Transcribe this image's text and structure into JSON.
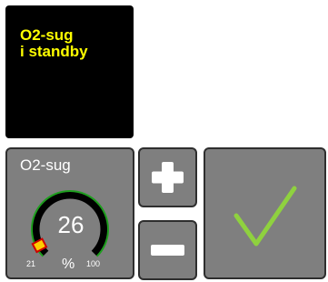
{
  "status": {
    "line1": "O2-sug",
    "line2": "i standby",
    "text_color": "#ffff00",
    "background": "#000000"
  },
  "gauge": {
    "title": "O2-sug",
    "value": "26",
    "unit": "%",
    "min_label": "21",
    "max_label": "100",
    "min": 21,
    "max": 100,
    "current": 26,
    "arc_color": "#1e9e1e",
    "track_color": "#000000",
    "marker_color": "#ffcc00",
    "marker_border": "#cc0000"
  },
  "controls": {
    "increase_icon": "plus-icon",
    "decrease_icon": "minus-icon",
    "confirm_icon": "checkmark-icon",
    "check_color": "#8fd13f"
  }
}
